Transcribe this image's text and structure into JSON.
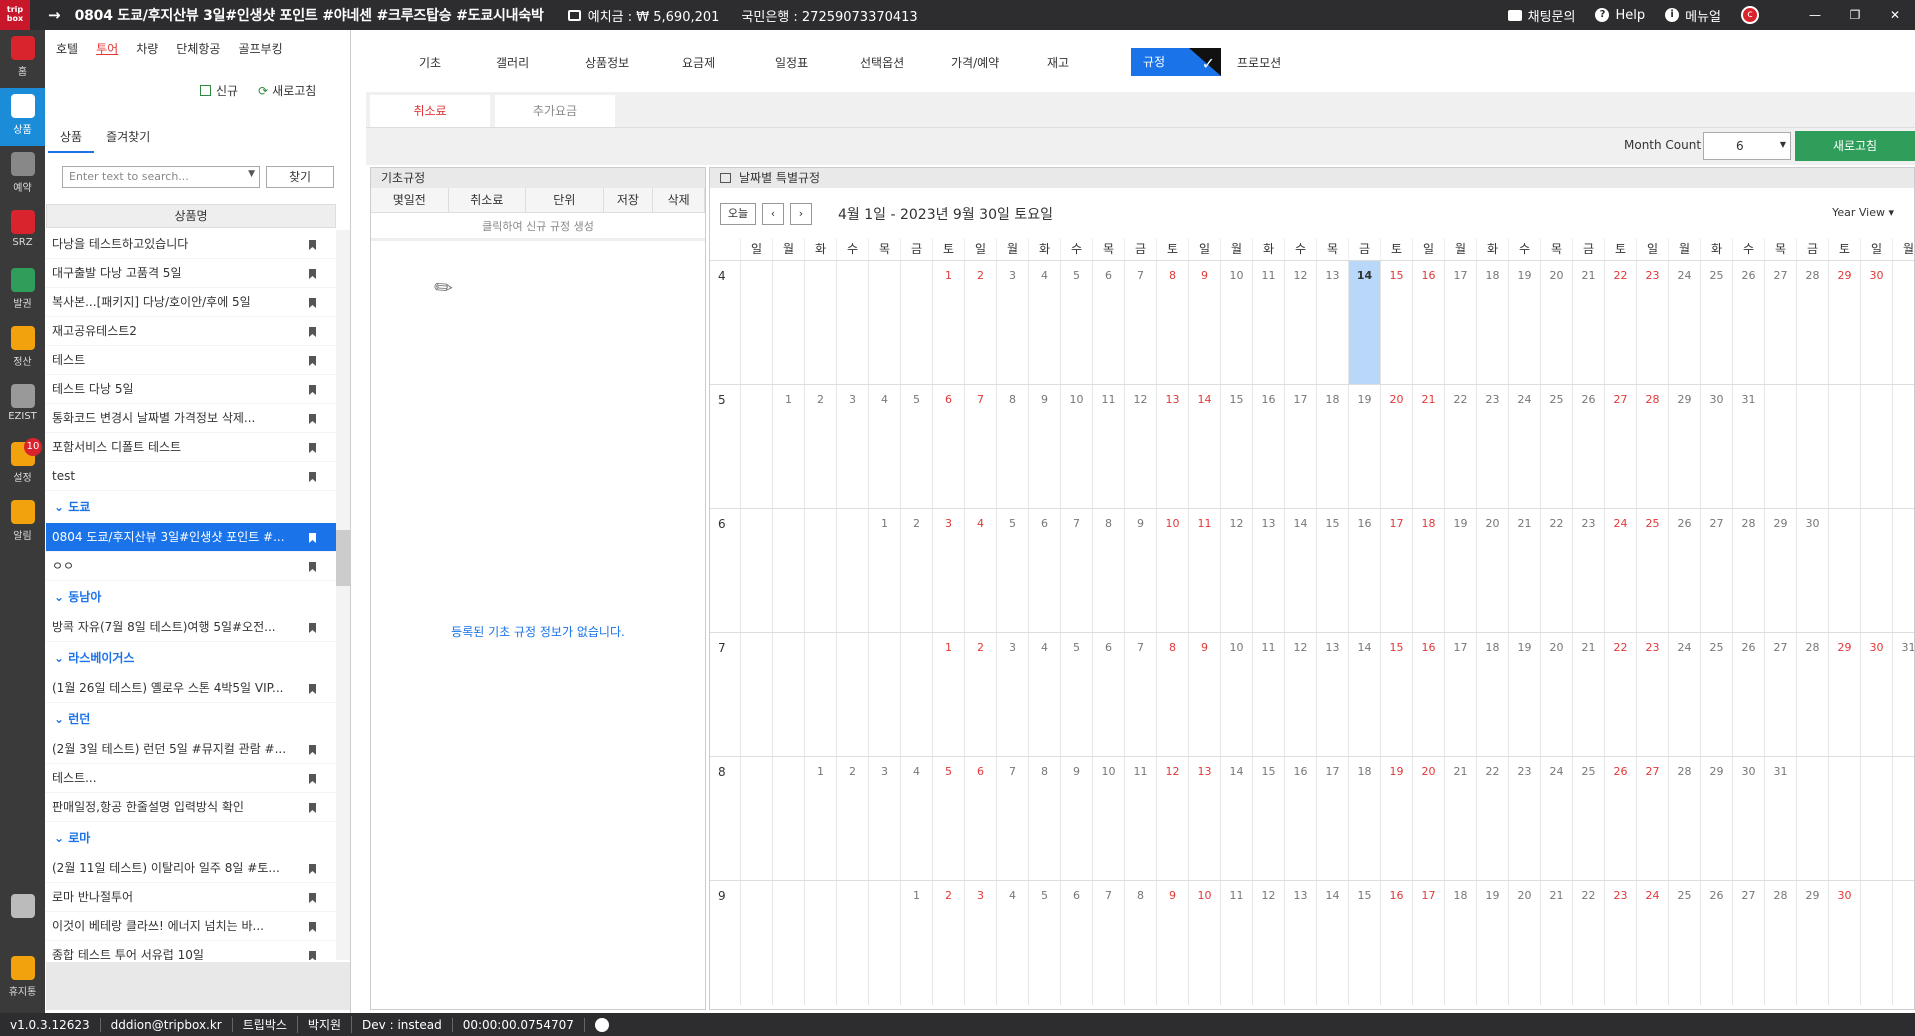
{
  "titlebar": {
    "logo": "trip box",
    "title": "0804 도쿄/후지산뷰 3일#인생샷 포인트 #야네센 #크루즈탑승 #도쿄시내숙박",
    "deposit": "예치금 : ₩ 5,690,201",
    "bank": "국민은행 : 27259073370413",
    "chat": "채팅문의",
    "help": "Help",
    "manual": "메뉴얼"
  },
  "leftbar": [
    {
      "label": "홈",
      "icon": "chart-icon"
    },
    {
      "label": "상품",
      "icon": "globe-icon"
    },
    {
      "label": "예약",
      "icon": "calendar-icon"
    },
    {
      "label": "SRZ",
      "icon": "share-icon"
    },
    {
      "label": "발권",
      "icon": "plane-icon"
    },
    {
      "label": "정산",
      "icon": "wallet-icon"
    },
    {
      "label": "EZIST",
      "icon": "globe2-icon"
    },
    {
      "label": "설정",
      "icon": "gear-icon",
      "badge": "10"
    },
    {
      "label": "알림",
      "icon": "chat-icon"
    },
    {
      "label": "",
      "icon": "apps-icon"
    },
    {
      "label": "휴지통",
      "icon": "trash-icon"
    }
  ],
  "categories": [
    "호텔",
    "투어",
    "차량",
    "단체항공",
    "골프부킹"
  ],
  "active_category": "투어",
  "left_tools": {
    "new": "신규",
    "refresh": "새로고침"
  },
  "left_tabs": [
    "상품",
    "즐겨찾기"
  ],
  "search": {
    "placeholder": "Enter text to search...",
    "button": "찾기"
  },
  "list_header": "상품명",
  "products": [
    {
      "type": "row",
      "text": "다낭을 테스트하고있습니다"
    },
    {
      "type": "row",
      "text": "대구출발 다낭 고품격 5일"
    },
    {
      "type": "row",
      "text": "복사본...[패키지] 다낭/호이안/후에 5일"
    },
    {
      "type": "row",
      "text": "재고공유테스트2"
    },
    {
      "type": "row",
      "text": "테스트"
    },
    {
      "type": "row",
      "text": "테스트 다낭 5일"
    },
    {
      "type": "row",
      "text": "통화코드 변경시 날짜별 가격정보 삭제..."
    },
    {
      "type": "row",
      "text": "포함서비스 디폴트 테스트"
    },
    {
      "type": "row",
      "text": "test"
    },
    {
      "type": "group",
      "text": "도쿄"
    },
    {
      "type": "row",
      "text": "0804 도쿄/후지산뷰 3일#인생샷 포인트 #...",
      "selected": true
    },
    {
      "type": "row",
      "text": "ㅇㅇ"
    },
    {
      "type": "group",
      "text": "동남아"
    },
    {
      "type": "row",
      "text": "방콕 자유(7월 8일 테스트)여행 5일#오전..."
    },
    {
      "type": "group",
      "text": "라스베이거스"
    },
    {
      "type": "row",
      "text": "(1월 26일 테스트) 옐로우 스톤 4박5일 VIP..."
    },
    {
      "type": "group",
      "text": "런던"
    },
    {
      "type": "row",
      "text": "(2월 3일 테스트) 런던 5일 #뮤지컬 관람 #..."
    },
    {
      "type": "row",
      "text": "테스트..."
    },
    {
      "type": "row",
      "text": "판매일정,항공 한줄설명 입력방식 확인"
    },
    {
      "type": "group",
      "text": "로마"
    },
    {
      "type": "row",
      "text": "(2월 11일 테스트) 이탈리아 일주 8일 #토..."
    },
    {
      "type": "row",
      "text": "로마 반나절투어"
    },
    {
      "type": "row",
      "text": "이것이 베테랑 클라쓰! 에너지 넘치는 바..."
    },
    {
      "type": "row",
      "text": "종합 테스트 투어 서유럽 10일"
    }
  ],
  "main_tabs": [
    "기초",
    "갤러리",
    "상품정보",
    "요금제",
    "일정표",
    "선택옵션",
    "가격/예약",
    "재고",
    "규정",
    "프로모션"
  ],
  "active_main_tab": "규정",
  "sub_tabs": [
    "취소료",
    "추가요금"
  ],
  "month_count": {
    "label": "Month Count",
    "value": "6",
    "refresh": "새로고침"
  },
  "base_rules": {
    "title": "기초규정",
    "columns": [
      "몇일전",
      "취소료",
      "단위",
      "저장",
      "삭제"
    ],
    "click_hint": "클릭하여 신규 규정 생성",
    "empty": "등록된 기초 규정 정보가 없습니다."
  },
  "calendar": {
    "title": "날짜별 특별규정",
    "today": "오늘",
    "range": "4월 1일 - 2023년 9월 30일 토요일",
    "view": "Year View",
    "weekdays": [
      "일",
      "월",
      "화",
      "수",
      "목",
      "금",
      "토",
      "일",
      "월",
      "화",
      "수",
      "목",
      "금",
      "토",
      "일",
      "월",
      "화",
      "수",
      "목",
      "금",
      "토",
      "일",
      "월",
      "화",
      "수",
      "목",
      "금",
      "토",
      "일",
      "월",
      "화",
      "수",
      "목",
      "금",
      "토",
      "일",
      "월"
    ],
    "months": [
      {
        "label": "4",
        "offset": 6,
        "days": 30,
        "weekend": [
          1,
          2,
          8,
          9,
          15,
          16,
          22,
          23,
          29,
          30
        ],
        "today": 14
      },
      {
        "label": "5",
        "offset": 1,
        "days": 31,
        "weekend": [
          6,
          7,
          13,
          14,
          20,
          21,
          27,
          28
        ]
      },
      {
        "label": "6",
        "offset": 4,
        "days": 30,
        "weekend": [
          3,
          4,
          10,
          11,
          17,
          18,
          24,
          25
        ]
      },
      {
        "label": "7",
        "offset": 6,
        "days": 31,
        "weekend": [
          1,
          2,
          8,
          9,
          15,
          16,
          22,
          23,
          29,
          30
        ]
      },
      {
        "label": "8",
        "offset": 2,
        "days": 31,
        "weekend": [
          5,
          6,
          12,
          13,
          19,
          20,
          26,
          27
        ]
      },
      {
        "label": "9",
        "offset": 5,
        "days": 30,
        "weekend": [
          2,
          3,
          9,
          10,
          16,
          17,
          23,
          24,
          30
        ]
      }
    ]
  },
  "statusbar": [
    "v1.0.3.12623",
    "dddion@tripbox.kr",
    "트립박스",
    "박지원",
    "Dev : instead",
    "00:00:00.0754707"
  ],
  "colors": {
    "accent": "#1a73e8",
    "weekend": "#e23838",
    "green": "#2e9e5a",
    "dark": "#2d2d30"
  }
}
